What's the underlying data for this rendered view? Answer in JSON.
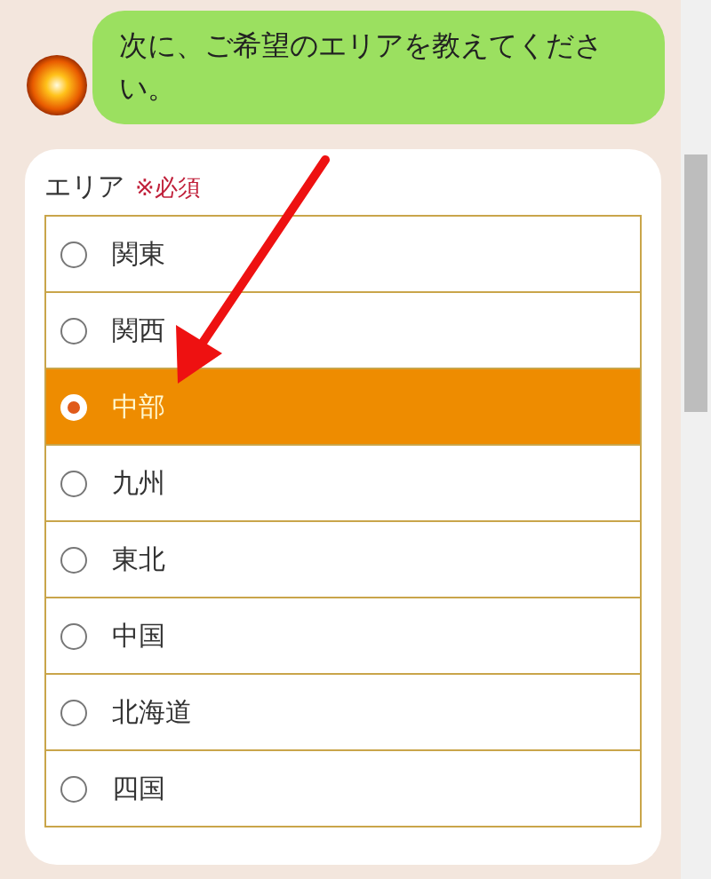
{
  "message": {
    "text": "次に、ご希望のエリアを教えてください。"
  },
  "form": {
    "label": "エリア",
    "required": "※必須",
    "options": [
      {
        "label": "関東",
        "selected": false
      },
      {
        "label": "関西",
        "selected": false
      },
      {
        "label": "中部",
        "selected": true
      },
      {
        "label": "九州",
        "selected": false
      },
      {
        "label": "東北",
        "selected": false
      },
      {
        "label": "中国",
        "selected": false
      },
      {
        "label": "北海道",
        "selected": false
      },
      {
        "label": "四国",
        "selected": false
      }
    ]
  }
}
